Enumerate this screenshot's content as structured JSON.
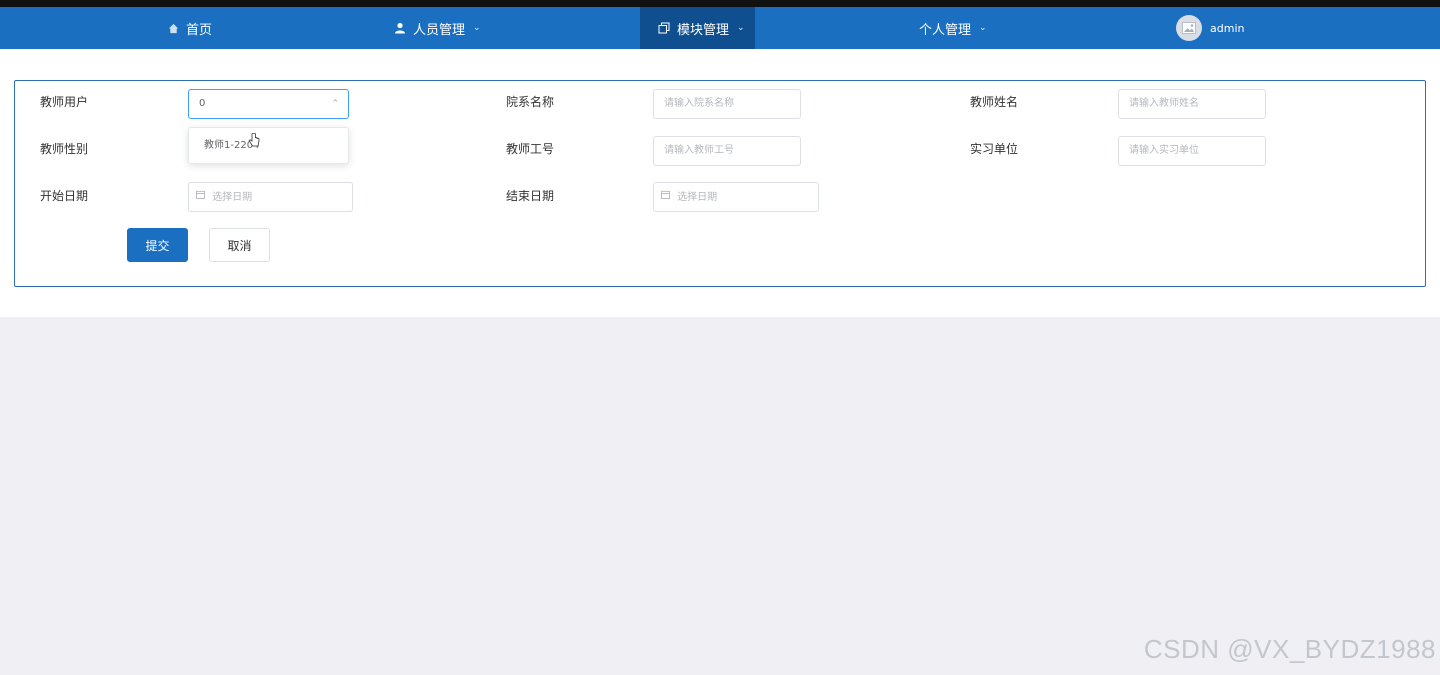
{
  "nav": {
    "home": "首页",
    "personnel": "人员管理",
    "modules": "模块管理",
    "personal": "个人管理",
    "user": "admin"
  },
  "form": {
    "teacher_user": {
      "label": "教师用户",
      "value": "0"
    },
    "department": {
      "label": "院系名称",
      "placeholder": "请输入院系名称"
    },
    "teacher_name": {
      "label": "教师姓名",
      "placeholder": "请输入教师姓名"
    },
    "teacher_gender": {
      "label": "教师性别"
    },
    "teacher_id": {
      "label": "教师工号",
      "placeholder": "请输入教师工号"
    },
    "internship_unit": {
      "label": "实习单位",
      "placeholder": "请输入实习单位"
    },
    "start_date": {
      "label": "开始日期",
      "placeholder": "选择日期"
    },
    "end_date": {
      "label": "结束日期",
      "placeholder": "选择日期"
    },
    "dropdown_option": "教师1-2204"
  },
  "buttons": {
    "submit": "提交",
    "cancel": "取消"
  },
  "watermark": "CSDN @VX_BYDZ1988",
  "colors": {
    "primary": "#1b6fc0",
    "nav_active": "#0f4f8f",
    "border": "#2d6fb0"
  }
}
